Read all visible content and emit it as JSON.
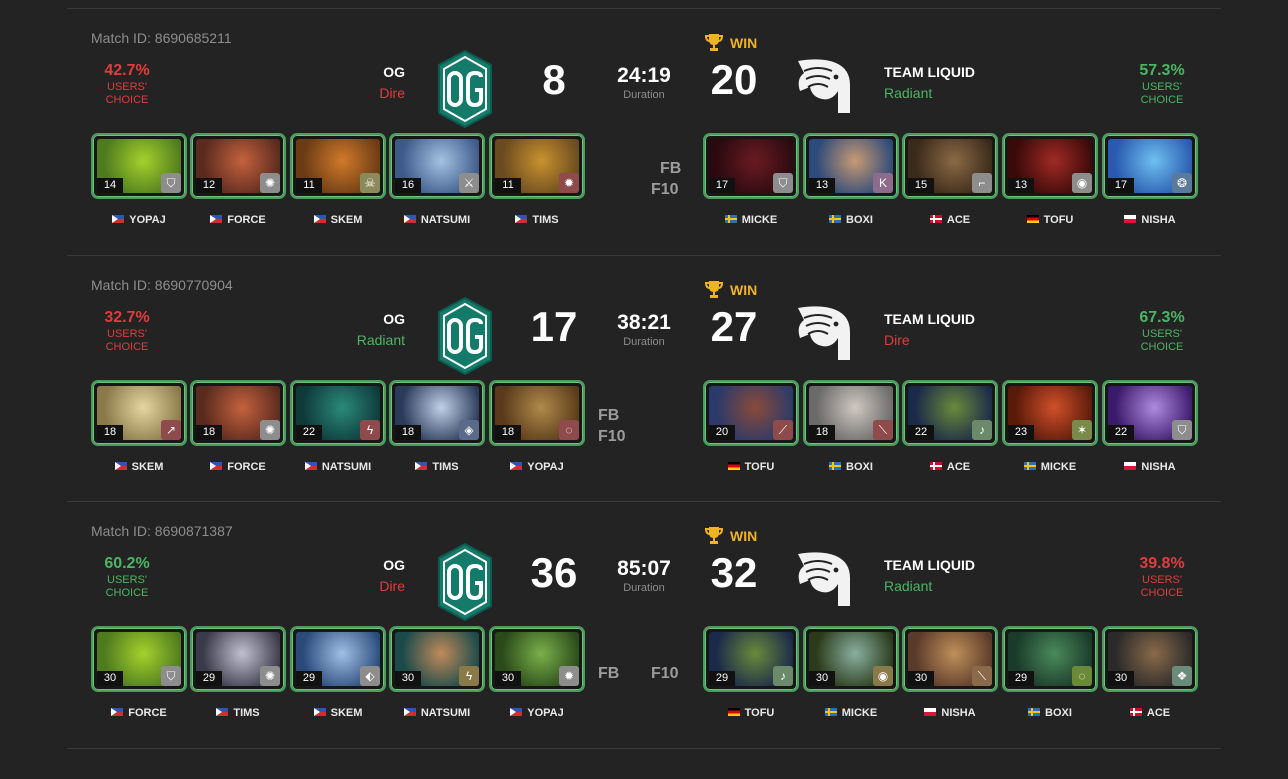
{
  "matches": [
    {
      "id_label": "Match ID: 8690685211",
      "left": {
        "pct": "42.7%",
        "pct_class": "red",
        "choice": "USERS' CHOICE",
        "team": "OG",
        "side": "Dire",
        "score": "8"
      },
      "right": {
        "pct": "57.3%",
        "pct_class": "green",
        "choice": "USERS' CHOICE",
        "team": "TEAM LIQUID",
        "side": "Radiant",
        "score": "20"
      },
      "duration": "24:19",
      "duration_label": "Duration",
      "win_label": "WIN",
      "markers": [
        {
          "text": "FB",
          "side": "right-top"
        },
        {
          "text": "F10",
          "side": "right-bottom"
        }
      ],
      "left_heroes": [
        {
          "level": "14",
          "player": "YOPAJ",
          "flag": "ph",
          "colors": [
            "#4d7b1e",
            "#a5d12c"
          ],
          "facet": "shield-icon",
          "facet_color": "#8d8d8d"
        },
        {
          "level": "12",
          "player": "FORCE",
          "flag": "ph",
          "colors": [
            "#5a2a1f",
            "#c4623d"
          ],
          "facet": "sun-icon",
          "facet_color": "#8d8d8d"
        },
        {
          "level": "11",
          "player": "SKEM",
          "flag": "ph",
          "colors": [
            "#6a3b15",
            "#d17a2a"
          ],
          "facet": "skull-icon",
          "facet_color": "#8a8a5a"
        },
        {
          "level": "16",
          "player": "NATSUMI",
          "flag": "ph",
          "colors": [
            "#3d5a8a",
            "#a4c3e2"
          ],
          "facet": "sword-icon",
          "facet_color": "#8d8d8d"
        },
        {
          "level": "11",
          "player": "TIMS",
          "flag": "ph",
          "colors": [
            "#6a4a1f",
            "#c9922f"
          ],
          "facet": "fire-icon",
          "facet_color": "#8f4b4b"
        }
      ],
      "right_heroes": [
        {
          "level": "17",
          "player": "MICKE",
          "flag": "se",
          "colors": [
            "#2a0a0f",
            "#6b1b22"
          ],
          "facet": "shield-icon",
          "facet_color": "#8d8d8d"
        },
        {
          "level": "13",
          "player": "BOXI",
          "flag": "se",
          "colors": [
            "#2c4a7a",
            "#c89a73"
          ],
          "facet": "k-icon",
          "facet_color": "#8d6b8d"
        },
        {
          "level": "15",
          "player": "ACE",
          "flag": "dk",
          "colors": [
            "#3a2a1a",
            "#8c6a45"
          ],
          "facet": "boot-icon",
          "facet_color": "#8d8d8d"
        },
        {
          "level": "13",
          "player": "TOFU",
          "flag": "de",
          "colors": [
            "#3a0a0a",
            "#a12a24"
          ],
          "facet": "orb-icon",
          "facet_color": "#8d8d8d"
        },
        {
          "level": "17",
          "player": "NISHA",
          "flag": "pl",
          "colors": [
            "#2a5ab0",
            "#6ec0f0"
          ],
          "facet": "swirl-icon",
          "facet_color": "#5a7a9a"
        }
      ]
    },
    {
      "id_label": "Match ID: 8690770904",
      "left": {
        "pct": "32.7%",
        "pct_class": "red",
        "choice": "USERS' CHOICE",
        "team": "OG",
        "side": "Radiant",
        "score": "17"
      },
      "right": {
        "pct": "67.3%",
        "pct_class": "green",
        "choice": "USERS' CHOICE",
        "team": "TEAM LIQUID",
        "side": "Dire",
        "score": "27"
      },
      "duration": "38:21",
      "duration_label": "Duration",
      "win_label": "WIN",
      "markers": [
        {
          "text": "FB",
          "side": "left-top"
        },
        {
          "text": "F10",
          "side": "left-bottom"
        }
      ],
      "left_heroes": [
        {
          "level": "18",
          "player": "SKEM",
          "flag": "ph",
          "colors": [
            "#8a7a4a",
            "#e6d6a0"
          ],
          "facet": "slash-icon",
          "facet_color": "#8f4b4b"
        },
        {
          "level": "18",
          "player": "FORCE",
          "flag": "ph",
          "colors": [
            "#5a2a1f",
            "#c4623d"
          ],
          "facet": "sun-icon",
          "facet_color": "#8d8d8d"
        },
        {
          "level": "22",
          "player": "NATSUMI",
          "flag": "ph",
          "colors": [
            "#0f3a3a",
            "#2a8a7a"
          ],
          "facet": "bolt-icon",
          "facet_color": "#8f4b4b"
        },
        {
          "level": "18",
          "player": "TIMS",
          "flag": "ph",
          "colors": [
            "#2a3a5a",
            "#c0d0e6"
          ],
          "facet": "eye-icon",
          "facet_color": "#5a6a8a"
        },
        {
          "level": "18",
          "player": "YOPAJ",
          "flag": "ph",
          "colors": [
            "#5a3a1a",
            "#b08a4a"
          ],
          "facet": "ring-icon",
          "facet_color": "#8f4b4b"
        }
      ],
      "right_heroes": [
        {
          "level": "20",
          "player": "TOFU",
          "flag": "de",
          "colors": [
            "#2a3a6a",
            "#8a4a3a"
          ],
          "facet": "brush-icon",
          "facet_color": "#8f4b4b"
        },
        {
          "level": "18",
          "player": "BOXI",
          "flag": "se",
          "colors": [
            "#6a6a6a",
            "#d0c8c0"
          ],
          "facet": "blade-icon",
          "facet_color": "#8f4b4b"
        },
        {
          "level": "22",
          "player": "ACE",
          "flag": "dk",
          "colors": [
            "#1a2a4a",
            "#6a8a3a"
          ],
          "facet": "guitar-icon",
          "facet_color": "#6a8a6a"
        },
        {
          "level": "23",
          "player": "MICKE",
          "flag": "se",
          "colors": [
            "#5a1a0a",
            "#d0502a"
          ],
          "facet": "claw-icon",
          "facet_color": "#7a8a4a"
        },
        {
          "level": "22",
          "player": "NISHA",
          "flag": "pl",
          "colors": [
            "#3a1a6a",
            "#b08ae0"
          ],
          "facet": "shield-icon",
          "facet_color": "#8d8d8d"
        }
      ]
    },
    {
      "id_label": "Match ID: 8690871387",
      "left": {
        "pct": "60.2%",
        "pct_class": "green",
        "choice": "USERS' CHOICE",
        "team": "OG",
        "side": "Dire",
        "score": "36"
      },
      "right": {
        "pct": "39.8%",
        "pct_class": "red",
        "choice": "USERS' CHOICE",
        "team": "TEAM LIQUID",
        "side": "Radiant",
        "score": "32"
      },
      "duration": "85:07",
      "duration_label": "Duration",
      "win_label": "WIN",
      "markers": [
        {
          "text": "FB",
          "side": "left-mid"
        },
        {
          "text": "F10",
          "side": "right-mid"
        }
      ],
      "left_heroes": [
        {
          "level": "30",
          "player": "FORCE",
          "flag": "ph",
          "colors": [
            "#4d7b1e",
            "#a5d12c"
          ],
          "facet": "shield-icon",
          "facet_color": "#8d8d8d"
        },
        {
          "level": "29",
          "player": "TIMS",
          "flag": "ph",
          "colors": [
            "#3a3a4a",
            "#c0c0d0"
          ],
          "facet": "sun-icon",
          "facet_color": "#8d8d8d"
        },
        {
          "level": "29",
          "player": "SKEM",
          "flag": "ph",
          "colors": [
            "#2a4a7a",
            "#a0c0e6"
          ],
          "facet": "drop-icon",
          "facet_color": "#8d8d8d"
        },
        {
          "level": "30",
          "player": "NATSUMI",
          "flag": "ph",
          "colors": [
            "#1a4a4a",
            "#c08a5a"
          ],
          "facet": "bolt-icon",
          "facet_color": "#8a7a4a"
        },
        {
          "level": "30",
          "player": "YOPAJ",
          "flag": "ph",
          "colors": [
            "#2a4a1a",
            "#7ab04a"
          ],
          "facet": "fire-icon",
          "facet_color": "#8d8d8d"
        }
      ],
      "right_heroes": [
        {
          "level": "29",
          "player": "TOFU",
          "flag": "de",
          "colors": [
            "#1a2a4a",
            "#6a8a3a"
          ],
          "facet": "guitar-icon",
          "facet_color": "#6a8a6a"
        },
        {
          "level": "30",
          "player": "MICKE",
          "flag": "se",
          "colors": [
            "#2a3a1a",
            "#8ab0a0"
          ],
          "facet": "orb-icon",
          "facet_color": "#8a7a4a"
        },
        {
          "level": "30",
          "player": "NISHA",
          "flag": "pl",
          "colors": [
            "#5a3a2a",
            "#c0905a"
          ],
          "facet": "blade-icon",
          "facet_color": "#8a6a4a"
        },
        {
          "level": "29",
          "player": "BOXI",
          "flag": "se",
          "colors": [
            "#1a3a2a",
            "#4a8a5a"
          ],
          "facet": "ring-icon",
          "facet_color": "#6a8a3a"
        },
        {
          "level": "30",
          "player": "ACE",
          "flag": "dk",
          "colors": [
            "#2a2a2a",
            "#8a6a4a"
          ],
          "facet": "wolf-icon",
          "facet_color": "#6a8a7a"
        }
      ]
    }
  ]
}
